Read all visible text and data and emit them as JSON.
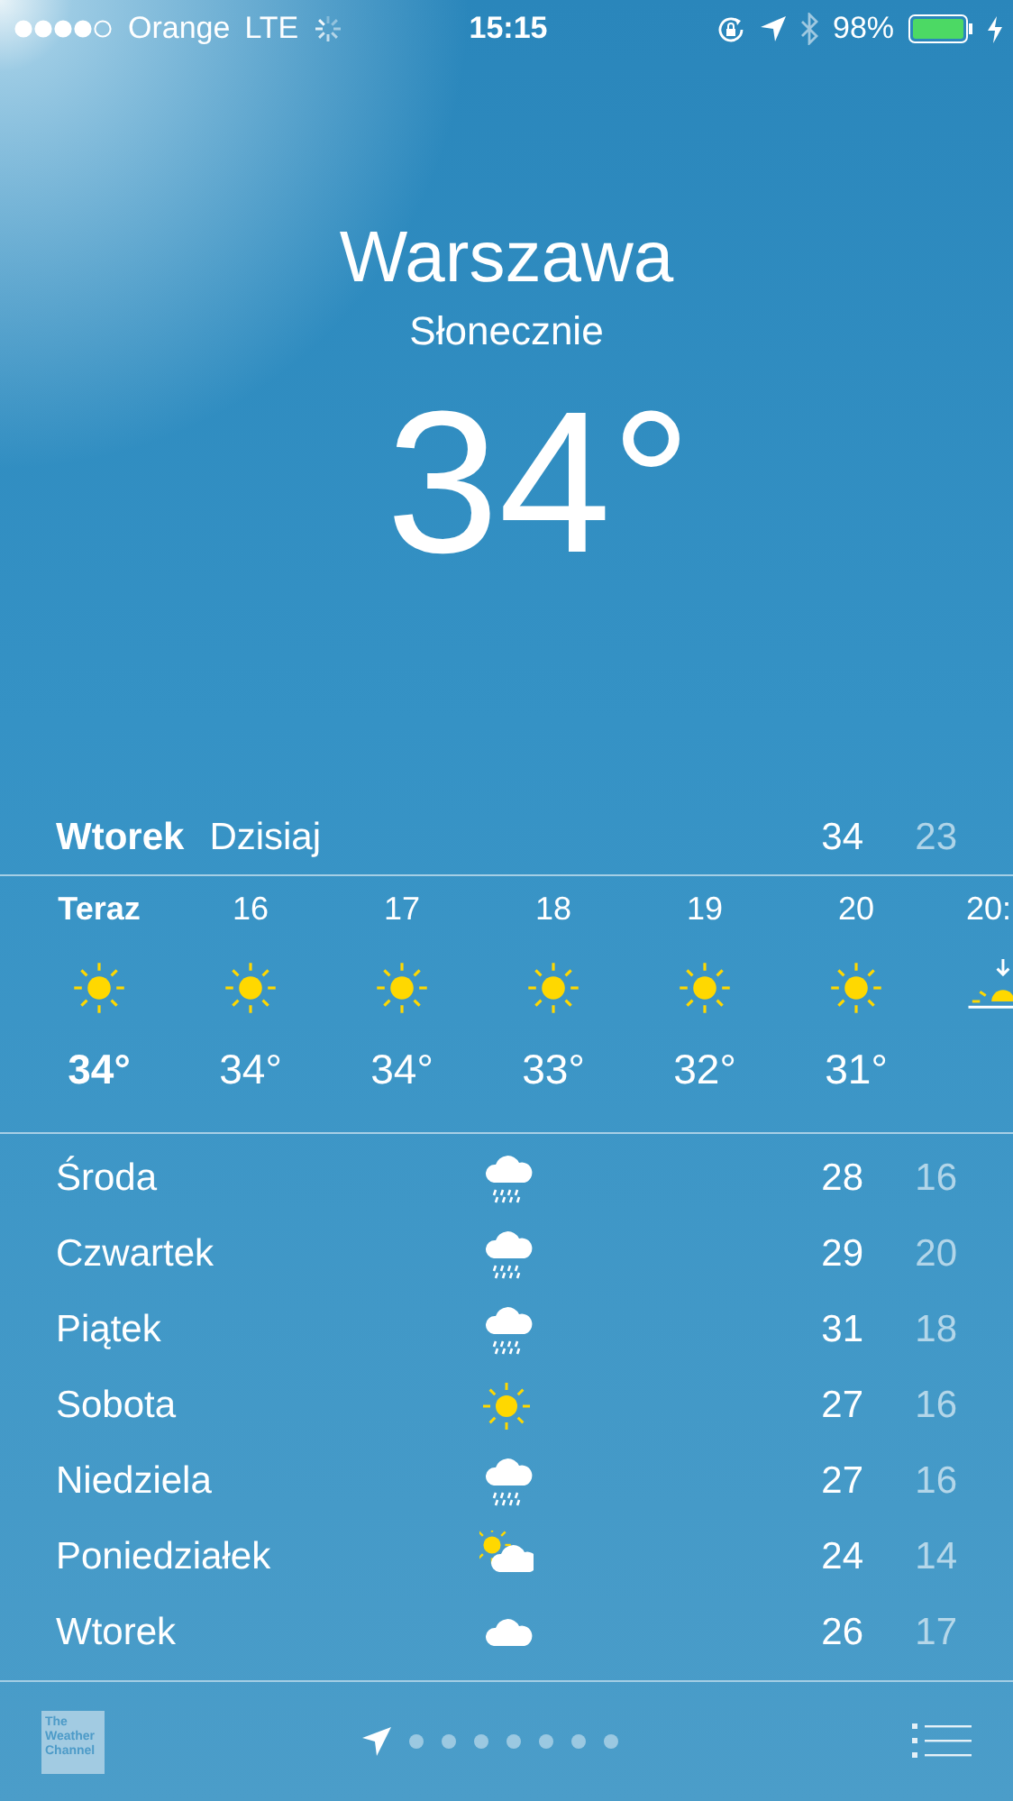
{
  "status_bar": {
    "carrier": "Orange",
    "network": "LTE",
    "time": "15:15",
    "battery_percent": "98%"
  },
  "location": {
    "city": "Warszawa",
    "condition": "Słonecznie",
    "temperature": "34°"
  },
  "today": {
    "day": "Wtorek",
    "label": "Dzisiaj",
    "high": "34",
    "low": "23"
  },
  "hourly": [
    {
      "time": "Teraz",
      "kind": "sun",
      "temp": "34°",
      "selected": true
    },
    {
      "time": "16",
      "kind": "sun",
      "temp": "34°",
      "selected": false
    },
    {
      "time": "17",
      "kind": "sun",
      "temp": "34°",
      "selected": false
    },
    {
      "time": "18",
      "kind": "sun",
      "temp": "33°",
      "selected": false
    },
    {
      "time": "19",
      "kind": "sun",
      "temp": "32°",
      "selected": false
    },
    {
      "time": "20",
      "kind": "sun",
      "temp": "31°",
      "selected": false
    },
    {
      "time": "20:",
      "kind": "sunset",
      "selected": false
    }
  ],
  "daily": [
    {
      "day": "Środa",
      "kind": "rain",
      "high": "28",
      "low": "16"
    },
    {
      "day": "Czwartek",
      "kind": "rain",
      "high": "29",
      "low": "20"
    },
    {
      "day": "Piątek",
      "kind": "rain",
      "high": "31",
      "low": "18"
    },
    {
      "day": "Sobota",
      "kind": "sun",
      "high": "27",
      "low": "16"
    },
    {
      "day": "Niedziela",
      "kind": "rain",
      "high": "27",
      "low": "16"
    },
    {
      "day": "Poniedziałek",
      "kind": "partly",
      "high": "24",
      "low": "14"
    },
    {
      "day": "Wtorek",
      "kind": "cloud",
      "high": "26",
      "low": "17"
    }
  ],
  "footer": {
    "logo_text": "The Weather Channel",
    "pages": [
      {
        "kind": "location",
        "selected": true
      },
      {
        "kind": "dot",
        "selected": false
      },
      {
        "kind": "dot",
        "selected": false
      },
      {
        "kind": "dot",
        "selected": false
      },
      {
        "kind": "dot",
        "selected": false
      },
      {
        "kind": "dot",
        "selected": false
      },
      {
        "kind": "dot",
        "selected": false
      },
      {
        "kind": "dot",
        "selected": false
      }
    ]
  }
}
